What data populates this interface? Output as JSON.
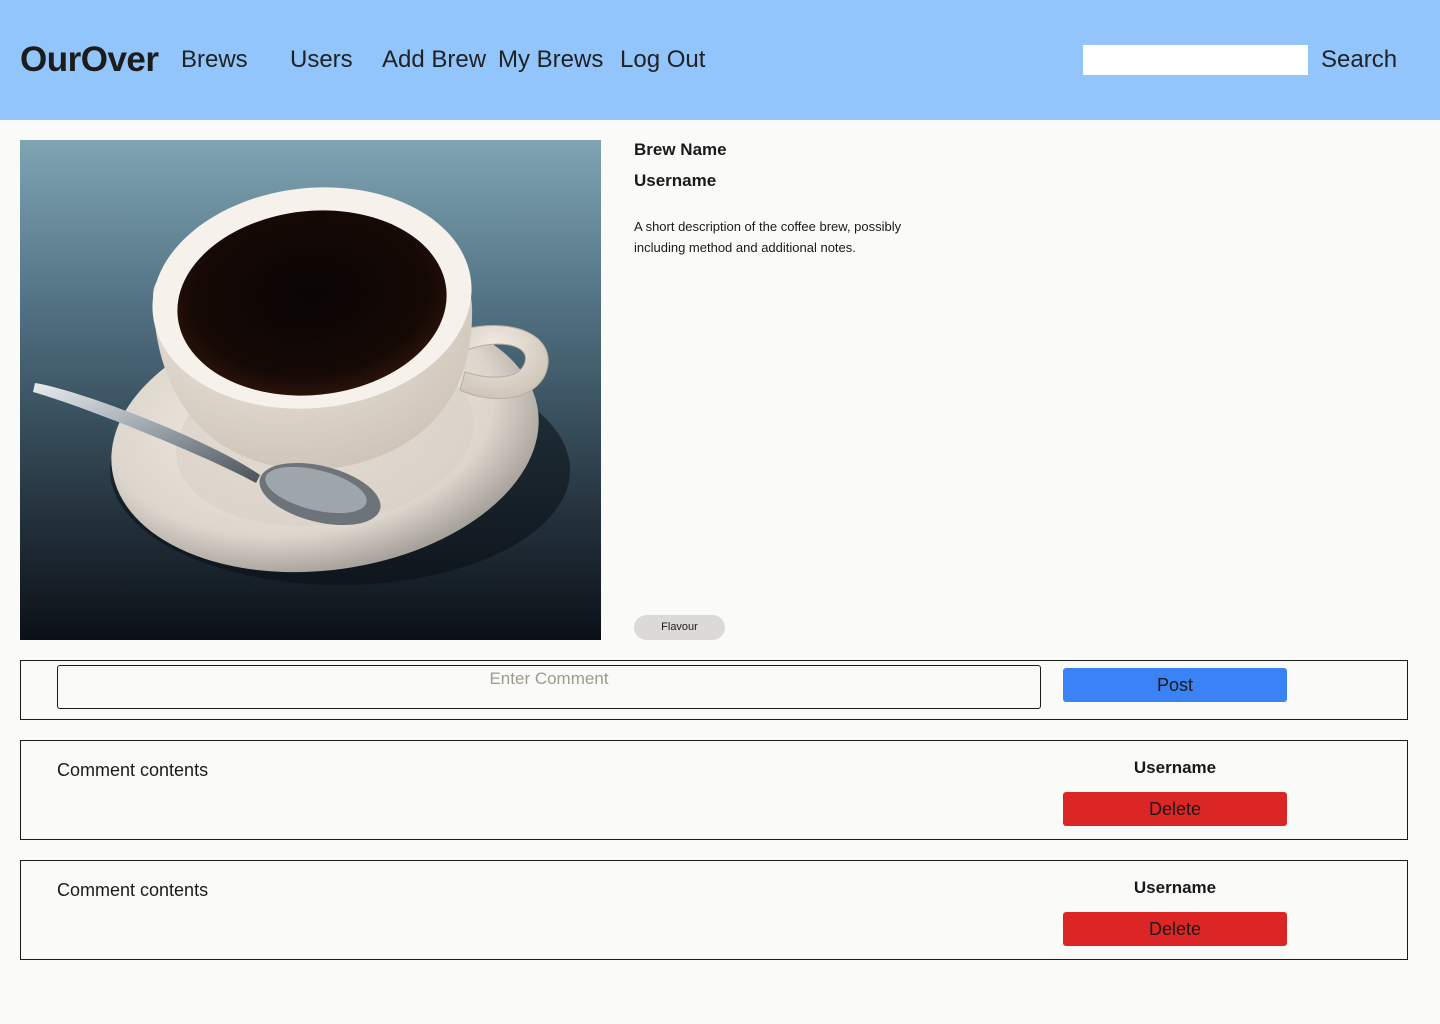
{
  "header": {
    "logo": "OurOver",
    "nav": [
      "Brews",
      "Users",
      "Add Brew",
      "My Brews",
      "Log Out"
    ],
    "search": {
      "value": "",
      "button_label": "Search"
    }
  },
  "brew": {
    "name": "Brew Name",
    "username": "Username",
    "description": "A short description of the coffee brew, possibly including method and additional notes.",
    "tag": "Flavour"
  },
  "comment_form": {
    "placeholder": "Enter Comment",
    "post_label": "Post"
  },
  "comments": [
    {
      "text": "Comment contents",
      "username": "Username",
      "delete_label": "Delete"
    },
    {
      "text": "Comment contents",
      "username": "Username",
      "delete_label": "Delete"
    }
  ],
  "colors": {
    "header_bg": "#92c5fb",
    "post_button": "#3b82f6",
    "delete_button": "#dc2626",
    "tag_bg": "#dcdad8"
  }
}
